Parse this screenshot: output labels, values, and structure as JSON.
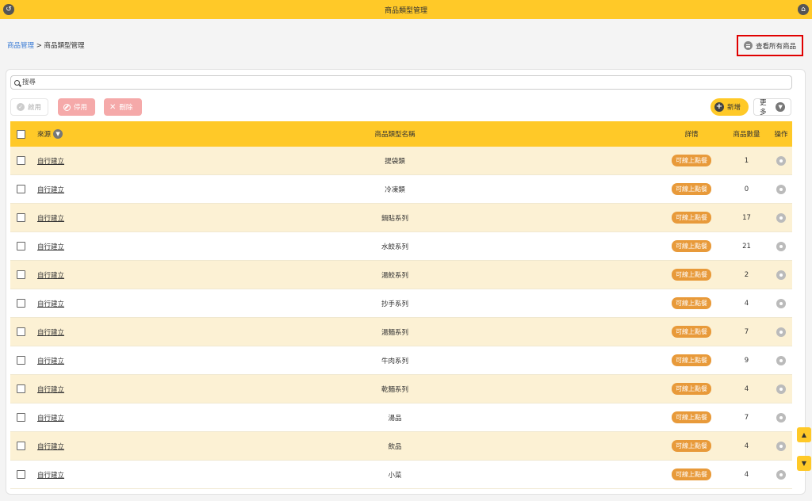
{
  "header": {
    "title": "商品類型管理"
  },
  "breadcrumb": {
    "parent": "商品管理",
    "separator": " > ",
    "current": "商品類型管理"
  },
  "view_all_button": "查看所有商品",
  "search": {
    "placeholder": "搜尋"
  },
  "toolbar": {
    "enable": "啟用",
    "disable": "停用",
    "delete": "刪除",
    "add": "新增",
    "more": "更多"
  },
  "table": {
    "columns": {
      "source": "來源",
      "name": "商品類型名稱",
      "detail": "詳情",
      "count": "商品數量",
      "op": "操作"
    },
    "rows": [
      {
        "source": "自行建立",
        "name": "提袋類",
        "detail": "可線上點餐",
        "count": "1"
      },
      {
        "source": "自行建立",
        "name": "冷凍類",
        "detail": "可線上點餐",
        "count": "0"
      },
      {
        "source": "自行建立",
        "name": "鍋貼系列",
        "detail": "可線上點餐",
        "count": "17"
      },
      {
        "source": "自行建立",
        "name": "水餃系列",
        "detail": "可線上點餐",
        "count": "21"
      },
      {
        "source": "自行建立",
        "name": "湯餃系列",
        "detail": "可線上點餐",
        "count": "2"
      },
      {
        "source": "自行建立",
        "name": "抄手系列",
        "detail": "可線上點餐",
        "count": "4"
      },
      {
        "source": "自行建立",
        "name": "湯麵系列",
        "detail": "可線上點餐",
        "count": "7"
      },
      {
        "source": "自行建立",
        "name": "牛肉系列",
        "detail": "可線上點餐",
        "count": "9"
      },
      {
        "source": "自行建立",
        "name": "乾麵系列",
        "detail": "可線上點餐",
        "count": "4"
      },
      {
        "source": "自行建立",
        "name": "湯品",
        "detail": "可線上點餐",
        "count": "7"
      },
      {
        "source": "自行建立",
        "name": "飲品",
        "detail": "可線上點餐",
        "count": "4"
      },
      {
        "source": "自行建立",
        "name": "小菜",
        "detail": "可線上點餐",
        "count": "4"
      }
    ]
  },
  "scroll": {
    "up": "▲",
    "down": "▼"
  },
  "colors": {
    "accent": "#ffc928",
    "badge": "#e89a3a",
    "danger_light": "#f5a9a9",
    "highlight_border": "#e00000",
    "link": "#3a7bd5"
  }
}
